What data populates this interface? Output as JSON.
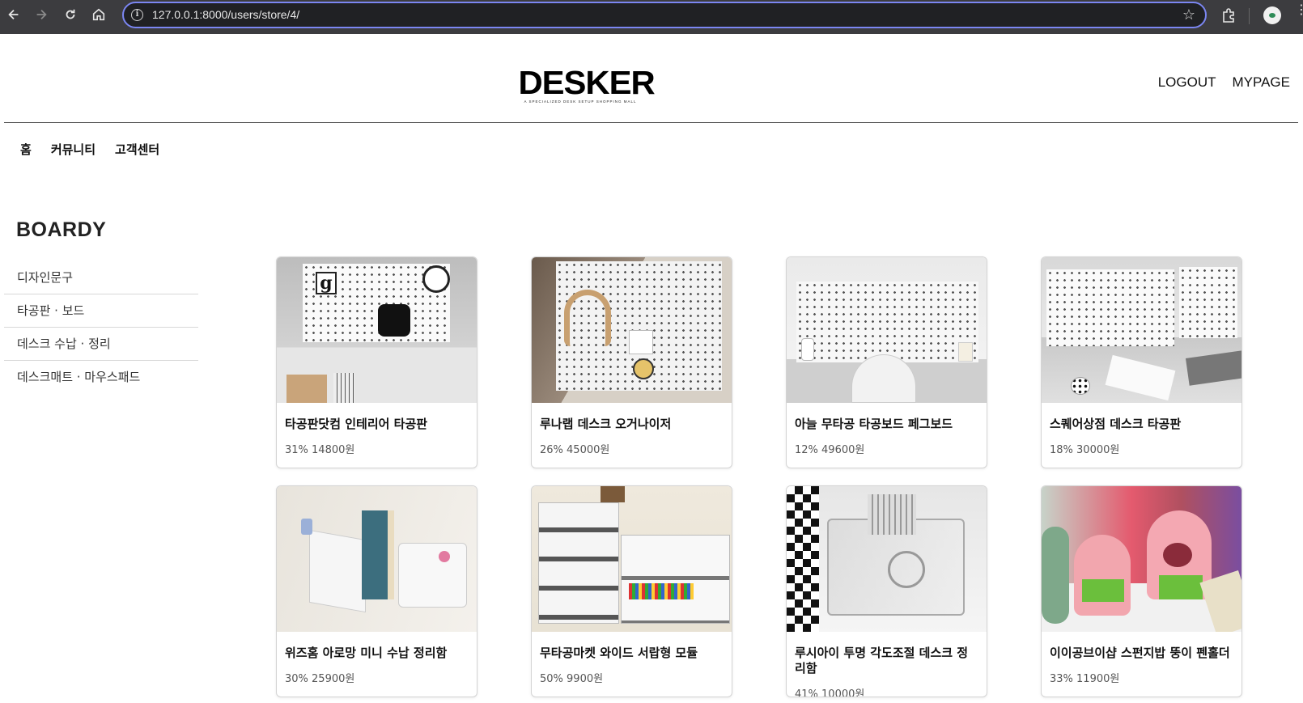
{
  "browser": {
    "url": "127.0.0.1:8000/users/store/4/"
  },
  "header": {
    "logo_text": "DESKER",
    "logo_tagline": "A SPECIALIZED DESK SETUP SHOPPING MALL",
    "links": [
      "LOGOUT",
      "MYPAGE"
    ]
  },
  "gnb": [
    "홈",
    "커뮤니티",
    "고객센터"
  ],
  "sidebar": {
    "title": "BOARDY",
    "items": [
      "디자인문구",
      "타공판 · 보드",
      "데스크 수납 · 정리",
      "데스크매트 · 마우스패드"
    ]
  },
  "products": [
    {
      "name": "타공판닷컴 인테리어 타공판",
      "price": "31% 14800원"
    },
    {
      "name": "루나랩 데스크 오거나이저",
      "price": "26% 45000원"
    },
    {
      "name": "아늘 무타공 타공보드 페그보드",
      "price": "12% 49600원"
    },
    {
      "name": "스퀘어상점 데스크 타공판",
      "price": "18% 30000원"
    },
    {
      "name": "위즈홈 아로망 미니 수납 정리함",
      "price": "30% 25900원"
    },
    {
      "name": "무타공마켓 와이드 서랍형 모듈",
      "price": "50% 9900원"
    },
    {
      "name": "루시아이 투명 각도조절 데스크 정리함",
      "price": "41% 10000원"
    },
    {
      "name": "이이공브이샵 스펀지밥 뚱이 펜홀더",
      "price": "33% 11900원"
    }
  ]
}
